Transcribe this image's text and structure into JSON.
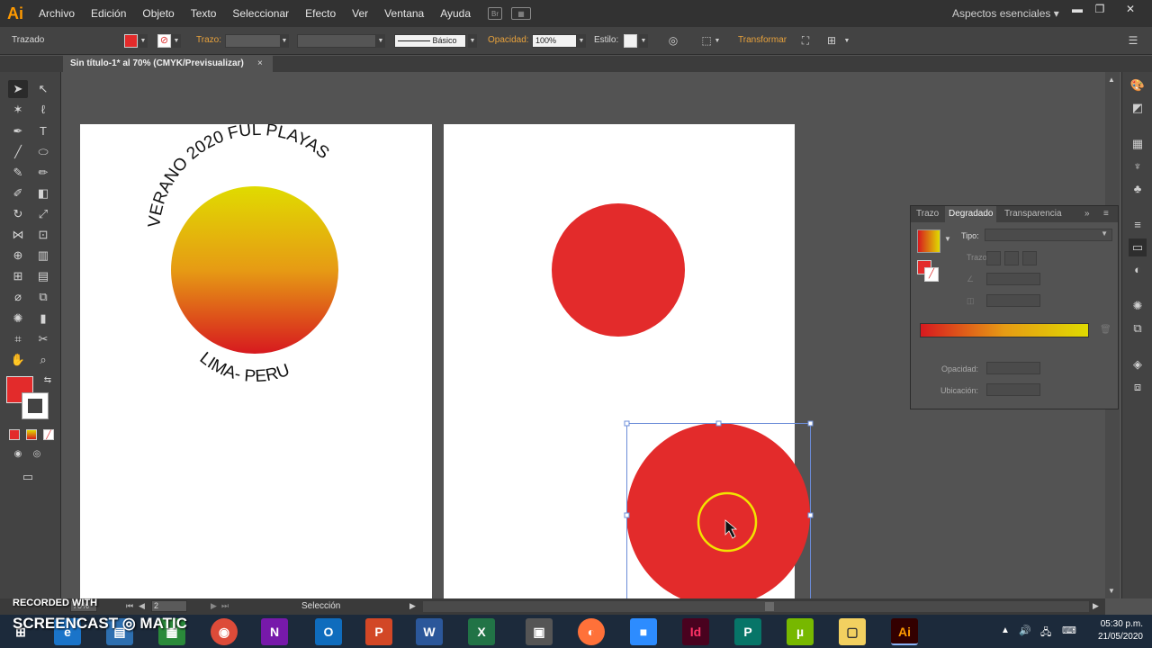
{
  "app": {
    "logo": "Ai",
    "workspace": "Aspectos esenciales"
  },
  "menu": [
    "Archivo",
    "Edición",
    "Objeto",
    "Texto",
    "Seleccionar",
    "Efecto",
    "Ver",
    "Ventana",
    "Ayuda"
  ],
  "menu_extra": {
    "bridge": "Br"
  },
  "control": {
    "selection_type": "Trazado",
    "stroke_label": "Trazo:",
    "brush": "Básico",
    "opacity_label": "Opacidad:",
    "opacity_value": "100%",
    "style_label": "Estilo:",
    "transform_label": "Transformar"
  },
  "tab": {
    "title": "Sin título-1* al 70% (CMYK/Previsualizar)",
    "close": "×"
  },
  "artwork": {
    "arc_top": "VERANO 2020 FUL PLAYAS",
    "arc_bottom": "LIMA- PERU"
  },
  "gradient_panel": {
    "tabs": [
      "Trazo",
      "Degradado",
      "Transparencia"
    ],
    "tipo_label": "Tipo:",
    "trazo_label": "Trazo:",
    "opacidad_label": "Opacidad:",
    "ubicacion_label": "Ubicación:"
  },
  "status": {
    "zoom": "70%",
    "page": "2",
    "tool": "Selección"
  },
  "watermark": {
    "line1": "RECORDED WITH",
    "line2": "SCREENCAST ◎ MATIC"
  },
  "taskbar": {
    "time": "05:30 p.m.",
    "date": "21/05/2020"
  },
  "colors": {
    "fill_red": "#e32b2b",
    "gradient_top": "#e0db00",
    "gradient_bottom": "#d7191f",
    "accent_orange": "#ff9a00"
  }
}
